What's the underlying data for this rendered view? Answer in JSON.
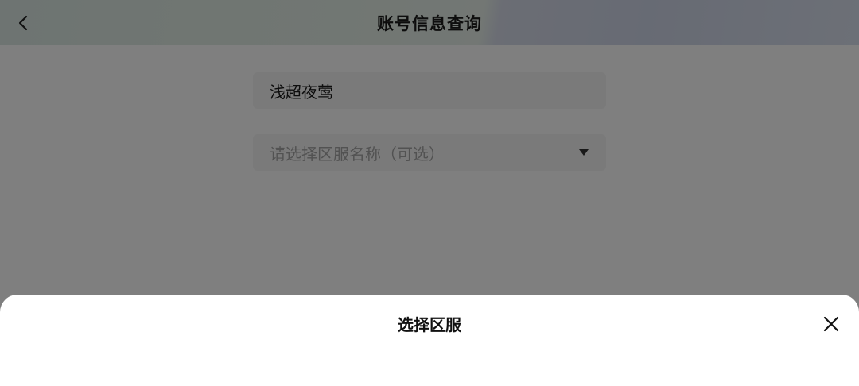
{
  "header": {
    "title": "账号信息查询",
    "back_icon": "chevron-left-icon"
  },
  "form": {
    "account_name": "浅超夜莺",
    "server_placeholder": "请选择区服名称（可选）",
    "dropdown_icon": "caret-down-icon"
  },
  "sheet": {
    "title": "选择区服",
    "close_icon": "close-icon"
  },
  "colors": {
    "overlay": "#000000",
    "placeholder": "#a5a5a5",
    "text": "#1a1a1a"
  }
}
